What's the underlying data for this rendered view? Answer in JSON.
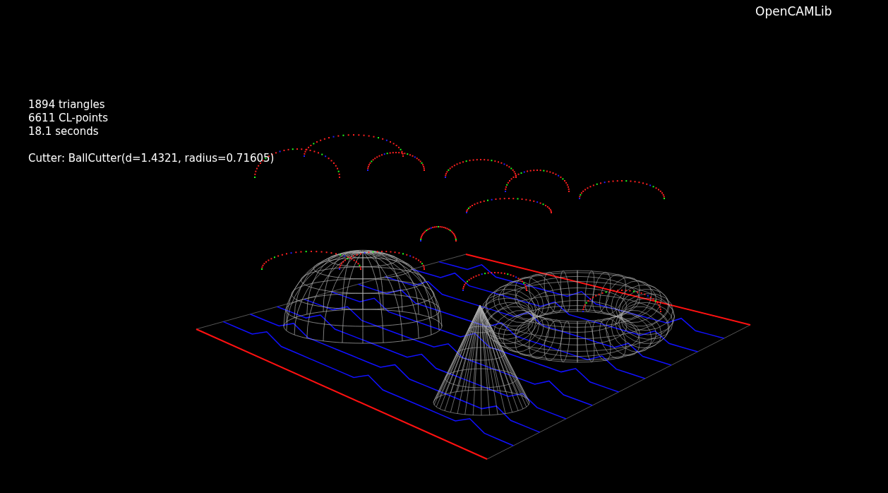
{
  "title": "OpenCAMLib",
  "stats": [
    "1894 triangles",
    "6611 CL-points",
    "18.1 seconds"
  ],
  "cutter": "Cutter: BallCutter(d=1.4321, radius=0.71605)"
}
